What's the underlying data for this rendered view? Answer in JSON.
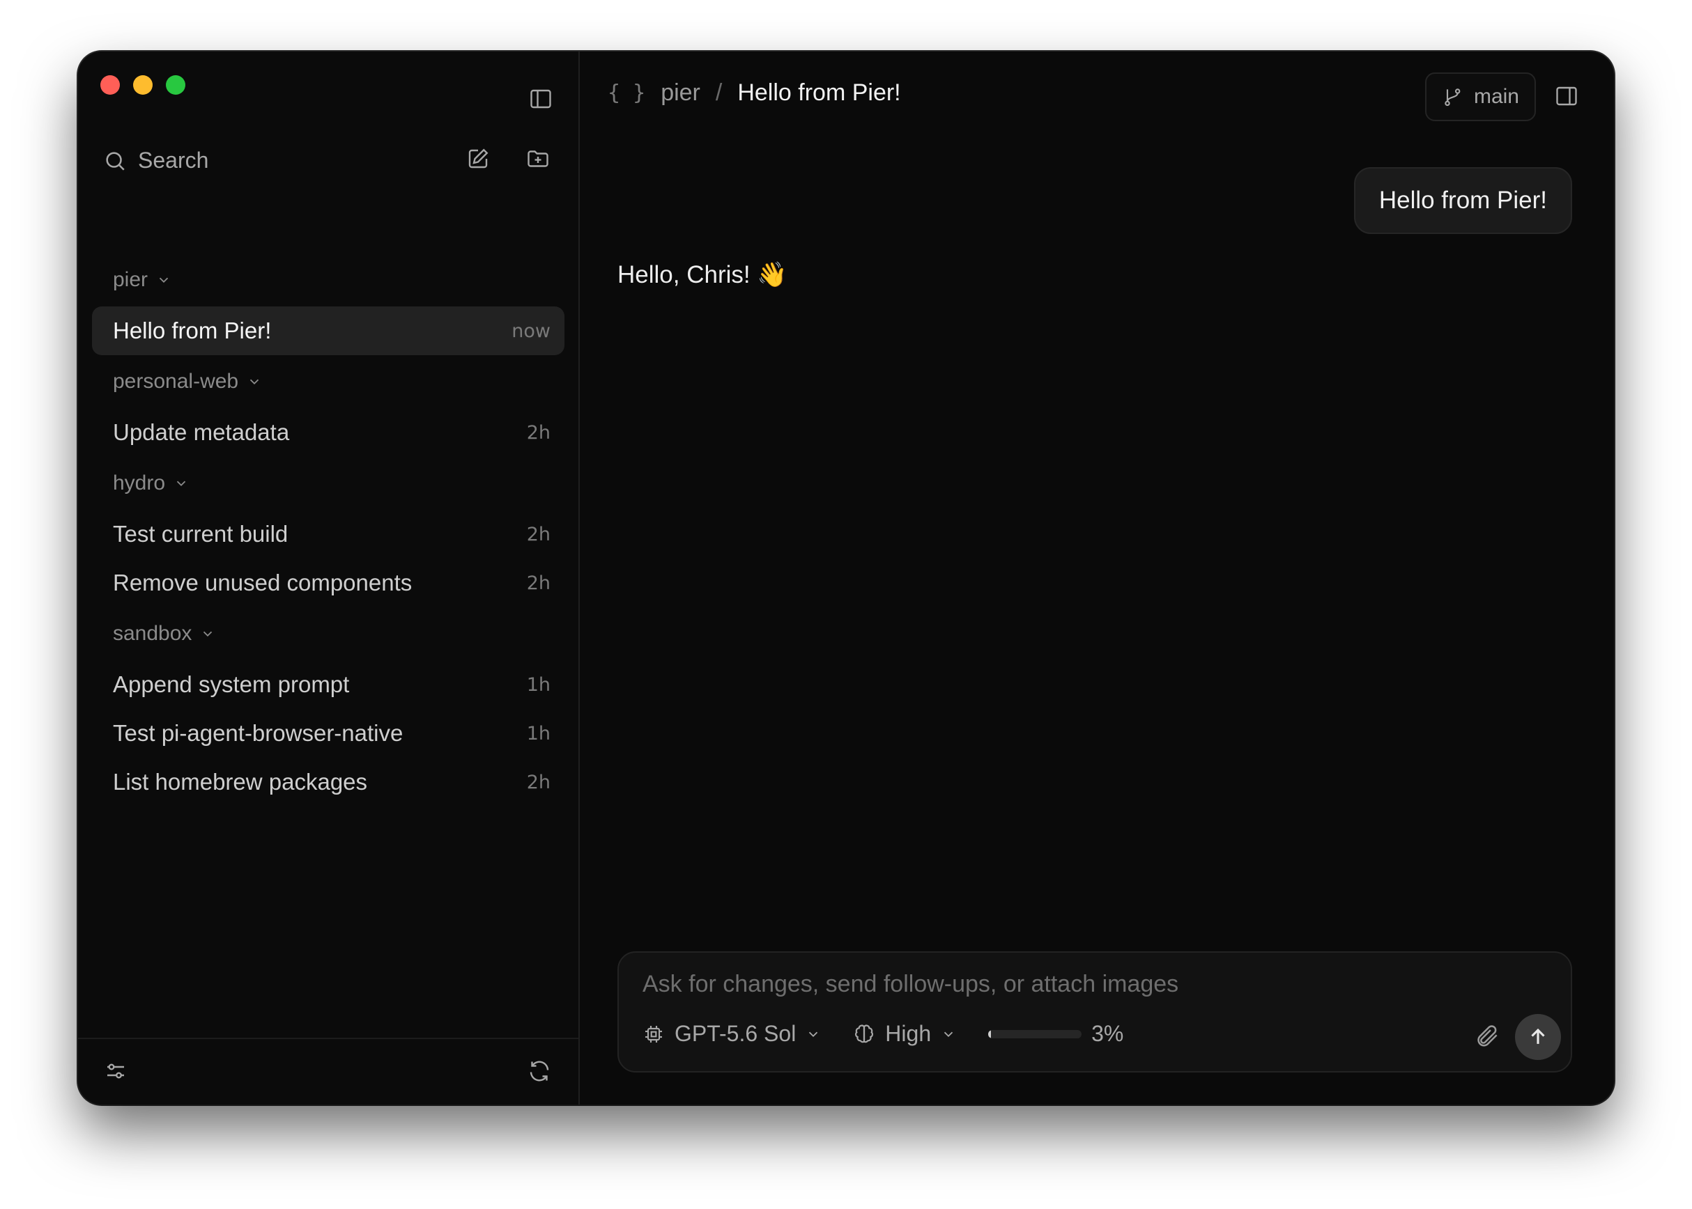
{
  "sidebar": {
    "search_label": "Search",
    "groups": [
      {
        "name": "pier",
        "items": [
          {
            "title": "Hello from Pier!",
            "time": "now",
            "active": true
          }
        ]
      },
      {
        "name": "personal-web",
        "items": [
          {
            "title": "Update metadata",
            "time": "2h"
          }
        ]
      },
      {
        "name": "hydro",
        "items": [
          {
            "title": "Test current build",
            "time": "2h"
          },
          {
            "title": "Remove unused components",
            "time": "2h"
          }
        ]
      },
      {
        "name": "sandbox",
        "items": [
          {
            "title": "Append system prompt",
            "time": "1h"
          },
          {
            "title": "Test pi-agent-browser-native",
            "time": "1h"
          },
          {
            "title": "List homebrew packages",
            "time": "2h"
          }
        ]
      }
    ]
  },
  "header": {
    "braces": "{ }",
    "project": "pier",
    "separator": "/",
    "current": "Hello from Pier!",
    "branch": "main"
  },
  "chat": {
    "user_message": "Hello from Pier!",
    "assistant_message": "Hello, Chris! 👋"
  },
  "composer": {
    "placeholder": "Ask for changes, send follow-ups, or attach images",
    "model": "GPT-5.6 Sol",
    "reasoning": "High",
    "context_usage_label": "3%",
    "context_usage_fraction": 0.03
  },
  "colors": {
    "window_bg": "#0a0a0a",
    "active_item_bg": "#222222",
    "traffic_close": "#ff5f57",
    "traffic_min": "#febc2e",
    "traffic_max": "#28c840"
  }
}
